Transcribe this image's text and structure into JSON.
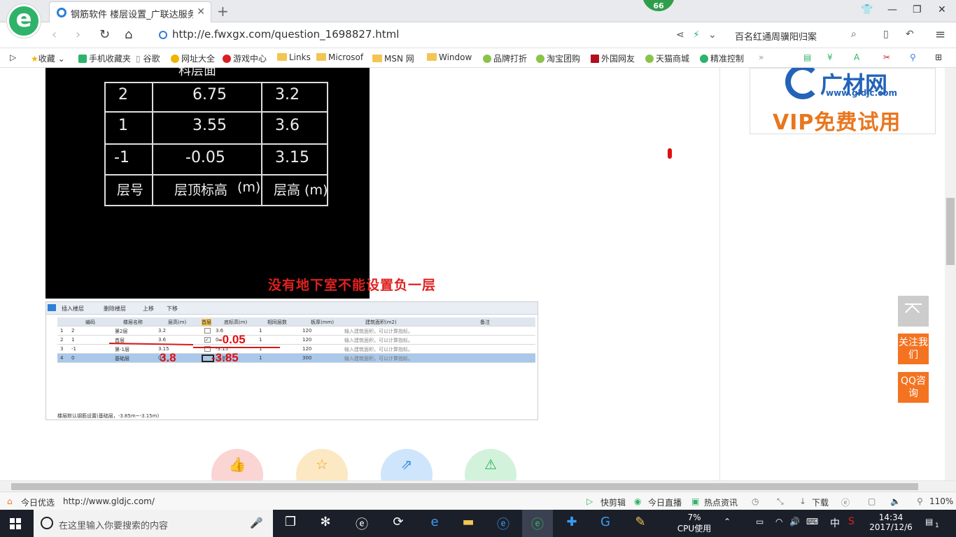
{
  "browser": {
    "tab_title": "钢筋软件 楼层设置_广联达服务新",
    "notification_badge": "66",
    "url": "http://e.fwxgx.com/question_1698827.html",
    "search_text": "百名红通周骥阳归案"
  },
  "bookmarks": [
    "收藏",
    "手机收藏夹",
    "谷歌",
    "网址大全",
    "游戏中心",
    "Links",
    "Microsof",
    "MSN 网",
    "Window",
    "品牌打折",
    "淘宝团购",
    "外国网友",
    "天猫商城",
    "精准控制"
  ],
  "cad_table": {
    "partial_header": "科层面",
    "rows": [
      {
        "floor": "2",
        "elev": "6.75",
        "height": "3.2"
      },
      {
        "floor": "1",
        "elev": "3.55",
        "height": "3.6"
      },
      {
        "floor": "-1",
        "elev": "-0.05",
        "height": "3.15"
      }
    ],
    "col_headers": {
      "floor": "层号",
      "elev": "层顶标高",
      "elev_unit": "(m)",
      "height": "层高 (m)"
    }
  },
  "caption": "没有地下室不能设置负一层",
  "software": {
    "toolbar": {
      "insert": "插入楼层",
      "delete": "删除楼层",
      "up": "上移",
      "down": "下移"
    },
    "headers": [
      "编码",
      "楼层名称",
      "层高(m)",
      "首层",
      "底标高(m)",
      "相同层数",
      "板厚(mm)",
      "建筑面积(m2)",
      "备注"
    ],
    "rows": [
      {
        "idx": "1",
        "code": "2",
        "name": "第2层",
        "height": "3.2",
        "first": "",
        "base": "3.6",
        "same": "1",
        "thick": "120",
        "area": "输入建筑面积，可以计算指标。"
      },
      {
        "idx": "2",
        "code": "1",
        "name": "首层",
        "height": "3.6",
        "first": "✓",
        "base": "0",
        "same": "1",
        "thick": "120",
        "area": "输入建筑面积，可以计算指标。"
      },
      {
        "idx": "3",
        "code": "-1",
        "name": "第-1层",
        "height": "3.15",
        "first": "",
        "base": "-3.15",
        "same": "1",
        "thick": "120",
        "area": "输入建筑面积，可以计算指标。"
      },
      {
        "idx": "4",
        "code": "0",
        "name": "基础层",
        "height": "0.7",
        "first": "",
        "base": "-3.85",
        "same": "1",
        "thick": "300",
        "area": "输入建筑面积，可以计算指标。"
      }
    ],
    "annotations": {
      "a1": "-0.05",
      "a2": "3.8",
      "a3": "-3.85"
    },
    "footer": "楼层默认钢筋设置(基础层，-3.85m~-3.15m)"
  },
  "ad": {
    "brand": "广材网",
    "url": "www.gldjc.com",
    "vip": "VIP免费试用"
  },
  "side_buttons": {
    "follow": "关注我们",
    "qq": "QQ咨询"
  },
  "status": {
    "today": "今日优选",
    "link": "http://www.gldjc.com/",
    "kuaijianji": "快剪辑",
    "live": "今日直播",
    "news": "热点资讯",
    "download": "下载",
    "zoom": "110%"
  },
  "taskbar": {
    "search_placeholder": "在这里输入你要搜索的内容",
    "cpu": "7%",
    "cpu_label": "CPU使用",
    "ime": "中",
    "time": "14:34",
    "date": "2017/12/6",
    "notif": "1"
  }
}
